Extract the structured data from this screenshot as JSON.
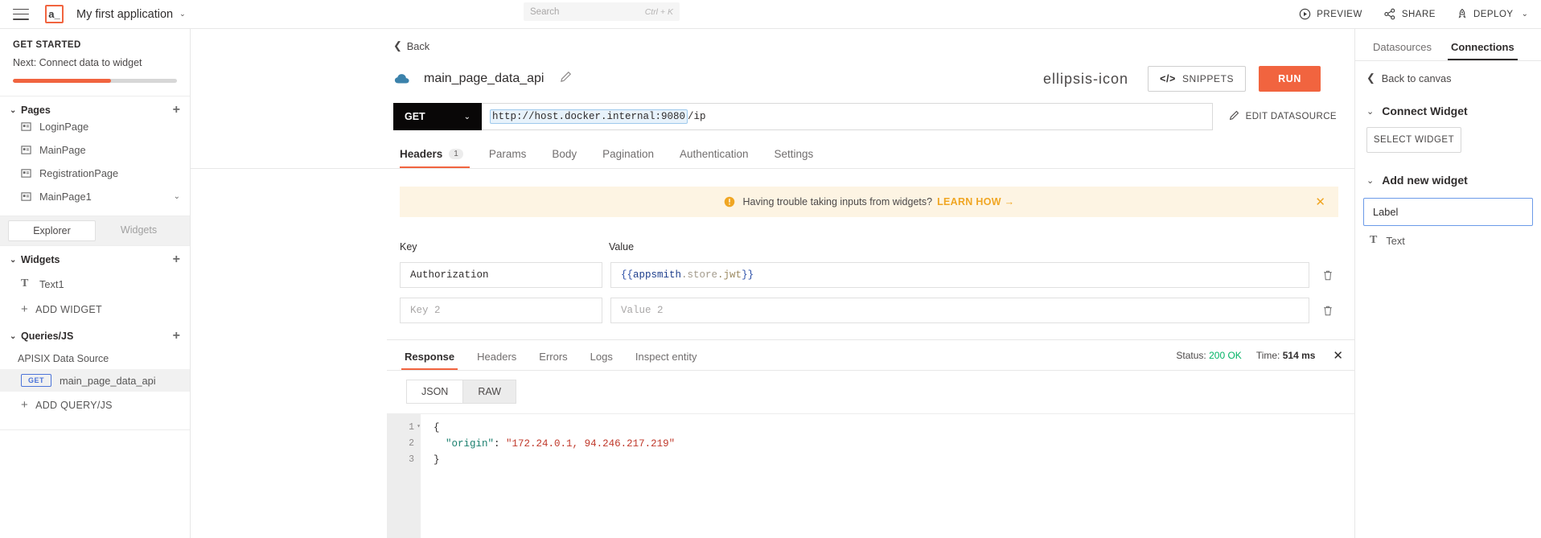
{
  "topbar": {
    "menu_icon": "hamburger-icon",
    "logo_text": "a_",
    "app_title": "My first application",
    "caret": "⌄",
    "search": {
      "placeholder": "Search",
      "shortcut": "Ctrl + K"
    },
    "actions": [
      {
        "label": "PREVIEW",
        "icon": "play-circle-icon"
      },
      {
        "label": "SHARE",
        "icon": "share-nodes-icon"
      },
      {
        "label": "DEPLOY",
        "icon": "rocket-icon"
      }
    ],
    "deploy_caret": "⌄"
  },
  "sidebar": {
    "get_started": {
      "title": "GET STARTED",
      "next_text": "Next: Connect data to widget",
      "progress_percent": 60
    },
    "pages": {
      "label": "Pages",
      "add": "+",
      "items": [
        {
          "label": "LoginPage",
          "icon": "page-icon"
        },
        {
          "label": "MainPage",
          "icon": "page-icon"
        },
        {
          "label": "RegistrationPage",
          "icon": "page-icon"
        },
        {
          "label": "MainPage1",
          "icon": "page-icon",
          "tail": "⌄"
        }
      ]
    },
    "switch": {
      "explorer": "Explorer",
      "widgets": "Widgets"
    },
    "widgets": {
      "label": "Widgets",
      "add": "+",
      "items": [
        {
          "label": "Text1",
          "icon": "text-widget-icon"
        }
      ],
      "add_widget": "ADD WIDGET"
    },
    "queries": {
      "label": "Queries/JS",
      "add": "+",
      "datasource_label": "APISIX Data Source",
      "items": [
        {
          "method": "GET",
          "name": "main_page_data_api"
        }
      ],
      "add_query": "ADD QUERY/JS"
    }
  },
  "center": {
    "back_label": "Back",
    "api_name": "main_page_data_api",
    "edit_icon": "pencil-icon",
    "more_icon": "ellipsis-icon",
    "snippets_label": "SNIPPETS",
    "snippets_icon": "</>",
    "run_label": "RUN",
    "method": "GET",
    "url_datasource": "http://host.docker.internal:9080",
    "url_path": "/ip",
    "edit_datasource": "EDIT DATASOURCE",
    "request_tabs": [
      {
        "label": "Headers",
        "badge": "1",
        "selected": true
      },
      {
        "label": "Params",
        "selected": false
      },
      {
        "label": "Body",
        "selected": false
      },
      {
        "label": "Pagination",
        "selected": false
      },
      {
        "label": "Authentication",
        "selected": false
      },
      {
        "label": "Settings",
        "selected": false
      }
    ],
    "warning": {
      "text": "Having trouble taking inputs from widgets?",
      "link": "LEARN HOW",
      "arrow": "→",
      "close": "✕"
    },
    "headers_table": {
      "col_key": "Key",
      "col_value": "Value",
      "rows": [
        {
          "key": "Authorization",
          "value": "{{appsmith.store.jwt}}",
          "key_placeholder": "",
          "value_placeholder": ""
        },
        {
          "key": "",
          "value": "",
          "key_placeholder": "Key 2",
          "value_placeholder": "Value 2"
        }
      ]
    }
  },
  "response": {
    "tabs": [
      {
        "label": "Response",
        "selected": true
      },
      {
        "label": "Headers",
        "selected": false
      },
      {
        "label": "Errors",
        "selected": false
      },
      {
        "label": "Logs",
        "selected": false
      },
      {
        "label": "Inspect entity",
        "selected": false
      }
    ],
    "status_label": "Status:",
    "status_value": "200 OK",
    "time_label": "Time:",
    "time_value": "514 ms",
    "close": "✕",
    "format_tabs": [
      {
        "label": "JSON",
        "selected": true
      },
      {
        "label": "RAW",
        "selected": false
      }
    ],
    "code": {
      "line_numbers": [
        "1",
        "2",
        "3"
      ],
      "lines": [
        {
          "punc": "{"
        },
        {
          "key": "\"origin\"",
          "colon": ": ",
          "value": "\"172.24.0.1, 94.246.217.219\""
        },
        {
          "punc": "}"
        }
      ]
    }
  },
  "rightpanel": {
    "tabs": [
      {
        "label": "Datasources",
        "selected": false
      },
      {
        "label": "Connections",
        "selected": true
      }
    ],
    "back_to_canvas": "Back to canvas",
    "connect_widget": {
      "title": "Connect Widget",
      "chevron": "⌄",
      "select_widget": "SELECT WIDGET"
    },
    "add_new_widget": {
      "title": "Add new widget",
      "chevron": "⌄",
      "input_value": "Label",
      "items": [
        {
          "label": "Text",
          "icon": "text-widget-icon"
        }
      ]
    }
  },
  "colors": {
    "accent": "#f1643f",
    "status_ok": "#03b365",
    "warning_bg": "#fdf4e3",
    "warning_fg": "#f0a623",
    "focus_blue": "#6b9ae8"
  }
}
